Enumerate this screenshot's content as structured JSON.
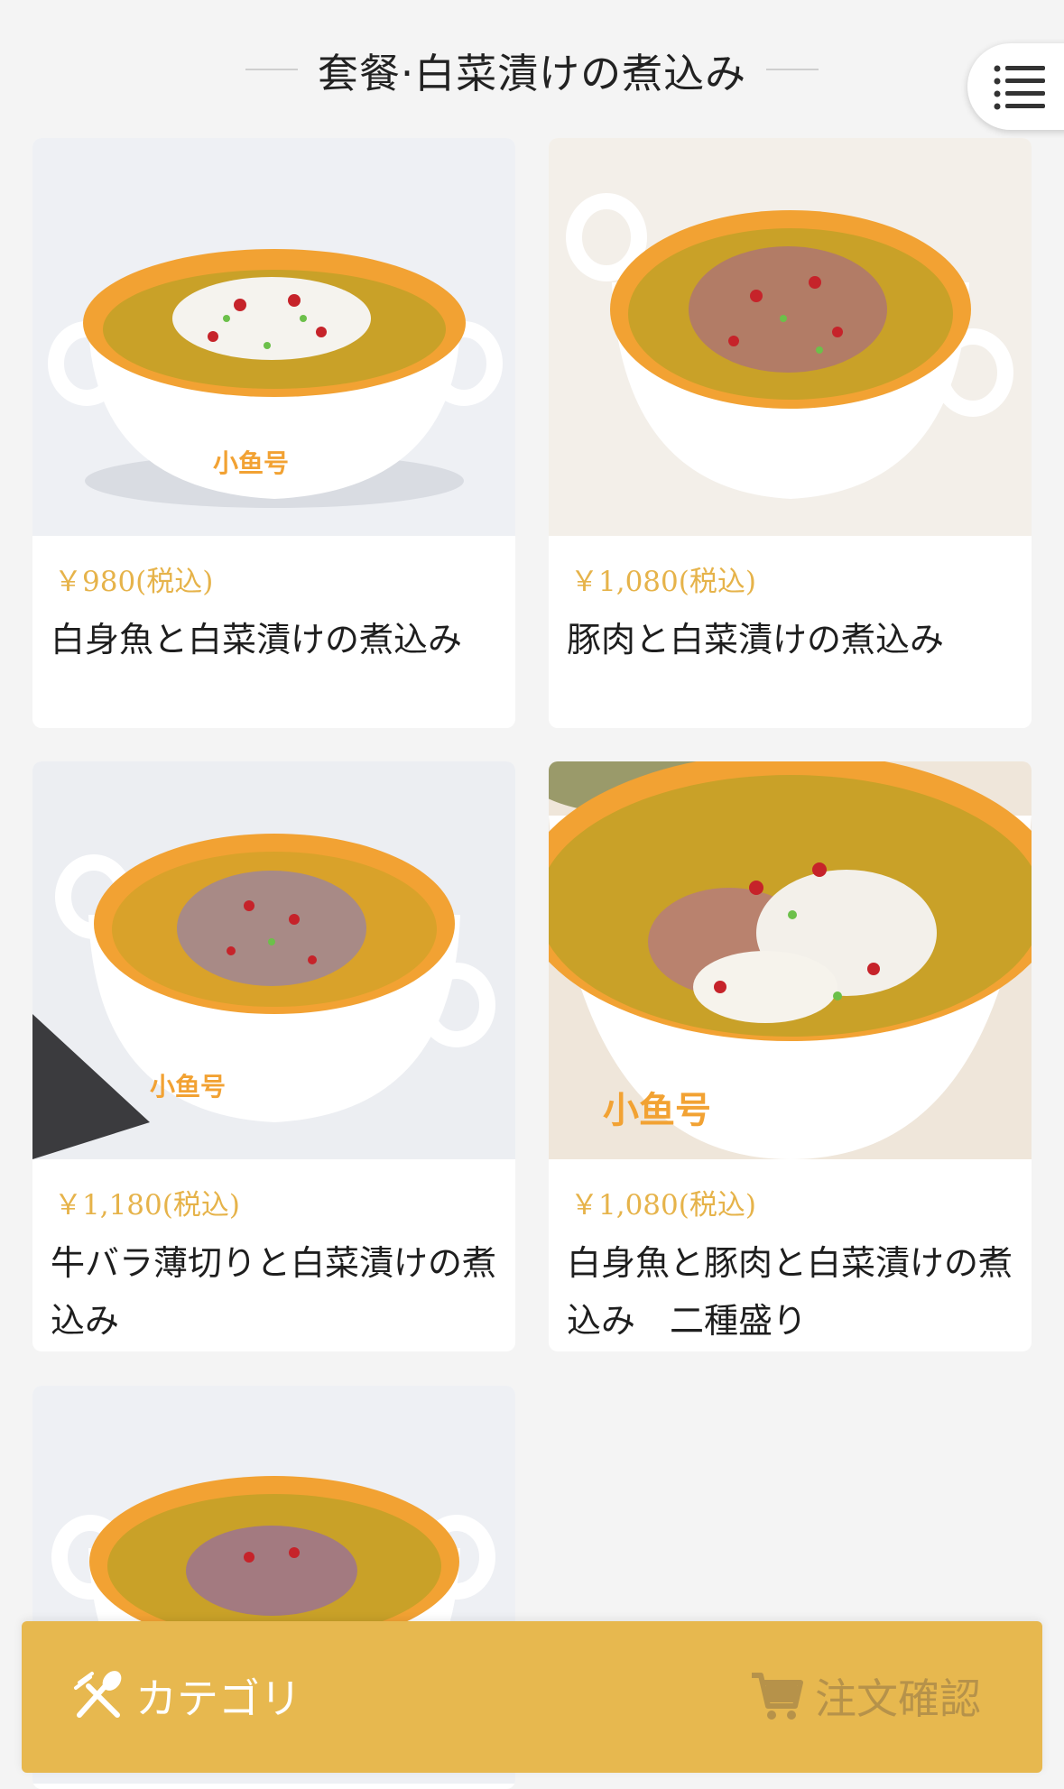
{
  "header": {
    "title": "套餐·白菜漬けの煮込み"
  },
  "menu_button": {
    "icon": "list-menu-icon"
  },
  "items": [
    {
      "price": "￥980(税込)",
      "name": "白身魚と白菜漬けの煮込み",
      "image": "fish-stew-photo"
    },
    {
      "price": "￥1,080(税込)",
      "name": "豚肉と白菜漬けの煮込み",
      "image": "pork-stew-photo"
    },
    {
      "price": "￥1,180(税込)",
      "name": "牛バラ薄切りと白菜漬けの煮込み",
      "image": "beef-stew-photo"
    },
    {
      "price": "￥1,080(税込)",
      "name": "白身魚と豚肉と白菜漬けの煮込み　二種盛り",
      "image": "fish-pork-stew-photo"
    },
    {
      "price": "",
      "name": "",
      "image": "stew-photo"
    }
  ],
  "bottom_bar": {
    "category_label": "カテゴリ",
    "category_icon": "fork-spoon-icon",
    "confirm_label": "注文確認",
    "confirm_icon": "cart-icon"
  },
  "colors": {
    "accent": "#e7b84f",
    "price": "#e6b34a",
    "bowl_rim": "#f2a233",
    "broth": "#c9a128"
  }
}
